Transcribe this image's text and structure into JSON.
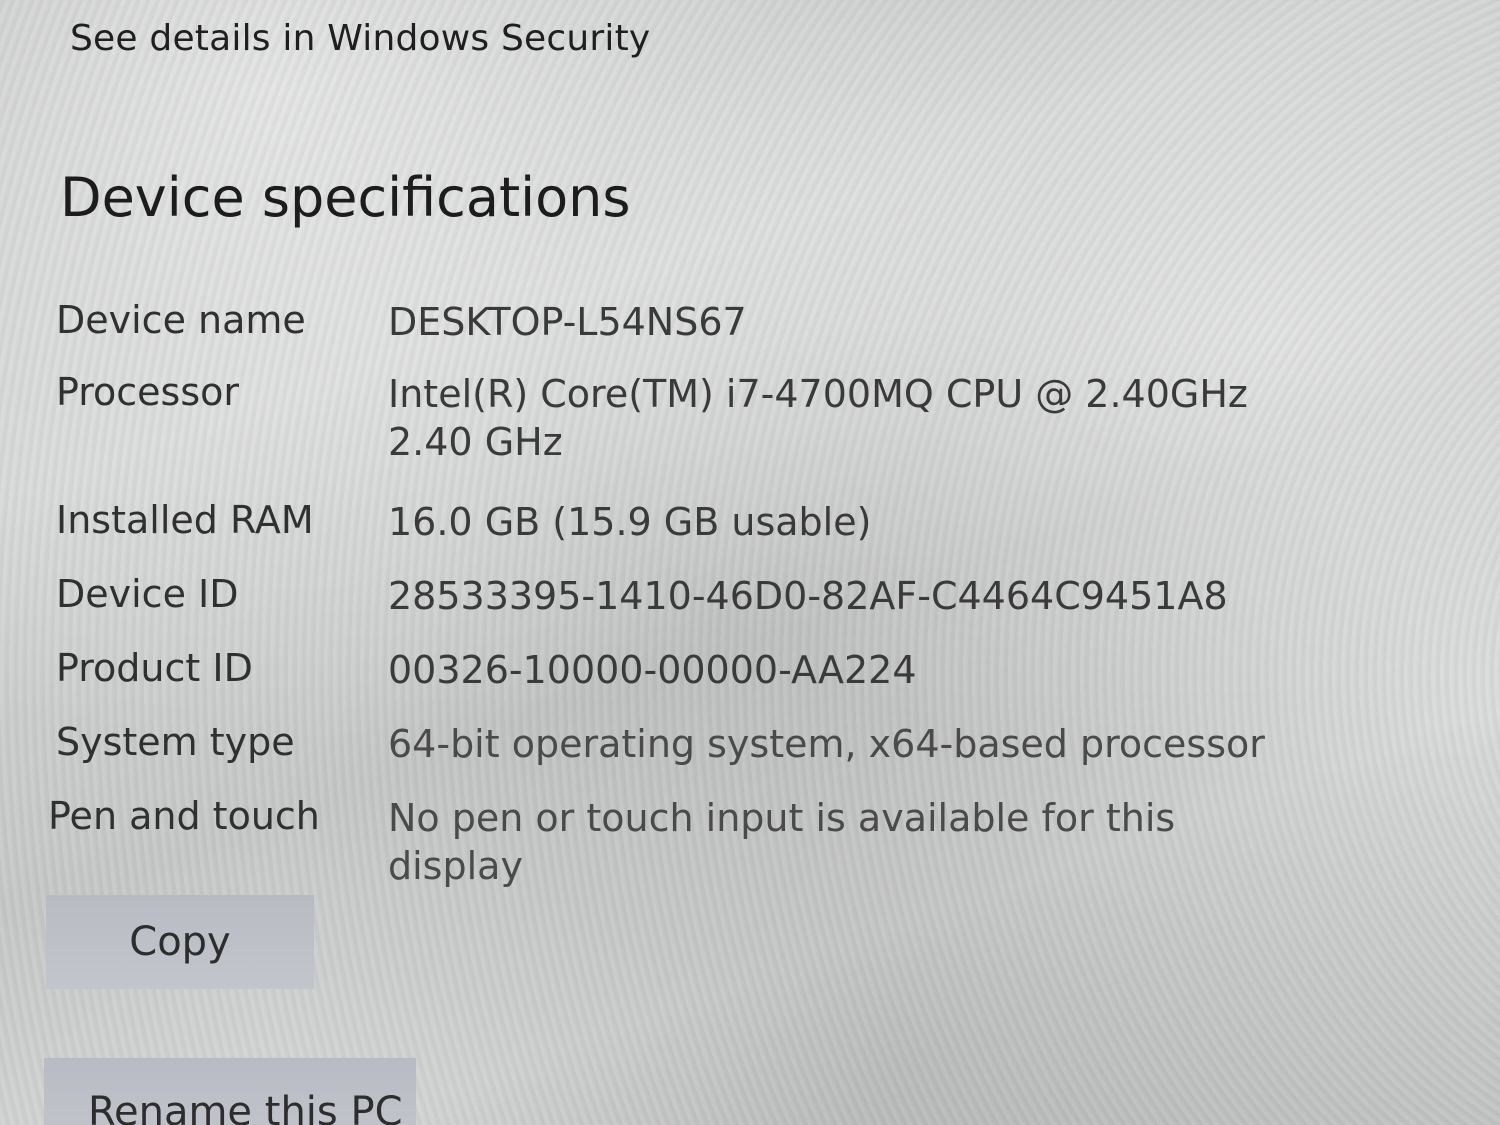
{
  "security_link": "See details in Windows Security",
  "section_title": "Device specifications",
  "specs": [
    {
      "label": "Device name",
      "value": "DESKTOP-L54NS67"
    },
    {
      "label": "Processor",
      "value": "Intel(R) Core(TM) i7-4700MQ CPU @ 2.40GHz   2.40 GHz"
    },
    {
      "label": "Installed RAM",
      "value": "16.0 GB (15.9 GB usable)"
    },
    {
      "label": "Device ID",
      "value": "28533395-1410-46D0-82AF-C4464C9451A8"
    },
    {
      "label": "Product ID",
      "value": "00326-10000-00000-AA224"
    },
    {
      "label": "System type",
      "value": "64-bit operating system, x64-based processor"
    },
    {
      "label": "Pen and touch",
      "value": "No pen or touch input is available for this display"
    }
  ],
  "buttons": {
    "copy": "Copy",
    "rename": "Rename this PC"
  }
}
